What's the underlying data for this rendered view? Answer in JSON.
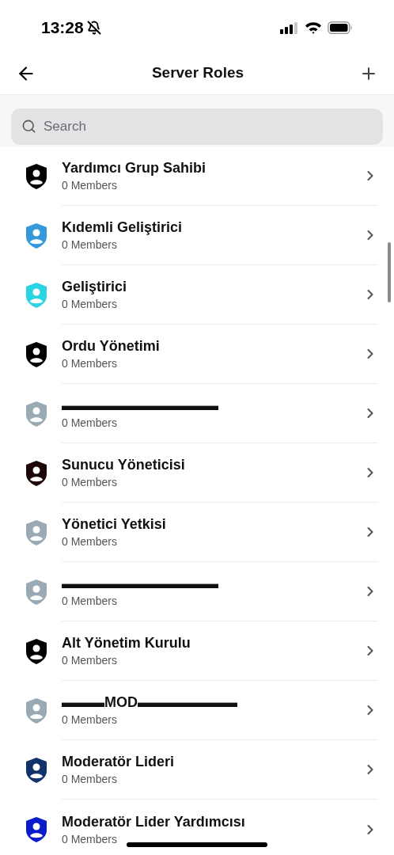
{
  "status_bar": {
    "time": "13:28"
  },
  "header": {
    "title": "Server Roles"
  },
  "search": {
    "placeholder": "Search"
  },
  "roles": [
    {
      "name": "Yardımcı Grup Sahibi",
      "members": "0 Members",
      "color": "#000000"
    },
    {
      "name": "Kıdemli Geliştirici",
      "members": "0 Members",
      "color": "#3498db"
    },
    {
      "name": "Geliştirici",
      "members": "0 Members",
      "color": "#2ad4e4"
    },
    {
      "name": "Ordu Yönetimi",
      "members": "0 Members",
      "color": "#000000"
    },
    {
      "name": "▬▬▬▬▬▬▬▬▬▬▬",
      "members": "0 Members",
      "color": "#99aab5"
    },
    {
      "name": "Sunucu Yöneticisi",
      "members": "0 Members",
      "color": "#1c0606"
    },
    {
      "name": "Yönetici Yetkisi",
      "members": "0 Members",
      "color": "#99aab5"
    },
    {
      "name": "▬▬▬▬▬▬▬▬▬▬▬",
      "members": "0 Members",
      "color": "#99aab5"
    },
    {
      "name": "Alt Yönetim Kurulu",
      "members": "0 Members",
      "color": "#000000"
    },
    {
      "name": "▬▬▬MOD▬▬▬▬▬▬▬",
      "members": "0 Members",
      "color": "#99aab5"
    },
    {
      "name": "Moderatör Lideri",
      "members": "0 Members",
      "color": "#11336b"
    },
    {
      "name": "Moderatör Lider Yardımcısı",
      "members": "0 Members",
      "color": "#0a1ccc"
    }
  ]
}
